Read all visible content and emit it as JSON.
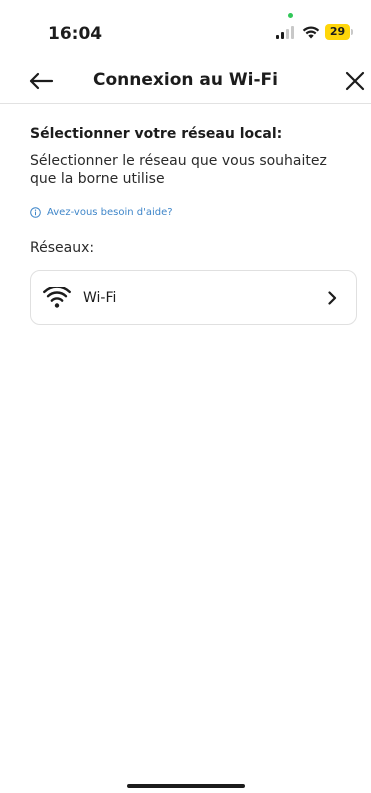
{
  "status_bar": {
    "time": "16:04",
    "battery": "29",
    "battery_color": "#ffd60a",
    "icons": [
      "signal-icon",
      "wifi-icon",
      "battery-icon"
    ]
  },
  "header": {
    "title": "Connexion au Wi-Fi",
    "back_icon": "arrow-left-icon",
    "close_icon": "close-icon"
  },
  "main": {
    "section_title": "Sélectionner votre réseau local:",
    "section_desc": "Sélectionner le réseau que vous souhaitez que la borne utilise",
    "help_link": "Avez-vous besoin d'aide?",
    "help_icon": "info-icon",
    "networks_label": "Réseaux:",
    "networks": [
      {
        "name": "Wi-Fi",
        "icon": "wifi-icon",
        "action_icon": "chevron-right-icon"
      }
    ]
  },
  "colors": {
    "link": "#3f86c9",
    "divider": "#e2e2e2",
    "card_border": "#e0e0e0"
  }
}
